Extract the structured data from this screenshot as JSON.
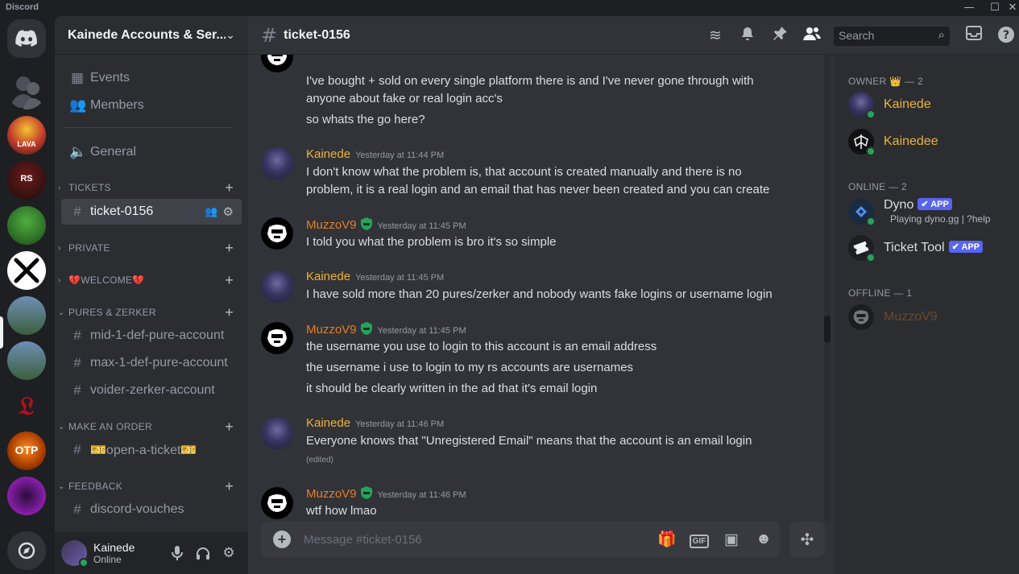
{
  "app": {
    "title": "Discord"
  },
  "window_controls": {
    "minimize": "—",
    "maximize": "☐",
    "close": "✕"
  },
  "server": {
    "name": "Kainede Accounts & Ser...",
    "rail_labels": {
      "lava": "LAVA",
      "rs": "RS",
      "otp": "OTP"
    }
  },
  "sidebar": {
    "events": "Events",
    "members": "Members",
    "general": "General",
    "categories": [
      {
        "label": "TICKETS",
        "channels": [
          "ticket-0156"
        ]
      },
      {
        "label": "PRIVATE",
        "channels": []
      },
      {
        "label": "💔WELCOME💔",
        "channels": []
      },
      {
        "label": "PURES & ZERKER",
        "channels": [
          "mid-1-def-pure-account",
          "max-1-def-pure-account",
          "voider-zerker-account"
        ]
      },
      {
        "label": "MAKE AN ORDER",
        "channels": [
          "🎫open-a-ticket🎫"
        ]
      },
      {
        "label": "FEEDBACK",
        "channels": [
          "discord-vouches"
        ]
      }
    ]
  },
  "user_panel": {
    "name": "Kainede",
    "status": "Online"
  },
  "channel": {
    "name": "ticket-0156"
  },
  "search": {
    "placeholder": "Search"
  },
  "messages": {
    "prev_lines": [
      "I've bought + sold on every single platform there is and I've never gone through with",
      "anyone about fake or real login acc's",
      "so whats the go here?"
    ],
    "groups": [
      {
        "author": "Kainede",
        "time": "Yesterday at 11:44 PM",
        "lines": [
          "I don't know what the problem is, that account is created manually and there is no",
          "problem, it is a real login and an email that has never been created and you can create"
        ]
      },
      {
        "author": "MuzzoV9",
        "time": "Yesterday at 11:45 PM",
        "lines": [
          "I told you what the problem is bro it's so simple"
        ]
      },
      {
        "author": "Kainede",
        "time": "Yesterday at 11:45 PM",
        "lines": [
          "I have sold more than 20 pures/zerker and nobody wants fake logins or username login"
        ]
      },
      {
        "author": "MuzzoV9",
        "time": "Yesterday at 11:45 PM",
        "lines": [
          "the username you use to login to this account is an email address",
          "the username i use to login to my rs accounts are usernames",
          "it should be clearly written in the ad that it's email login"
        ]
      },
      {
        "author": "Kainede",
        "time": "Yesterday at 11:46 PM",
        "lines": [
          "Everyone knows that \"Unregistered Email\" means that the account is an email login"
        ],
        "edited": "(edited)"
      },
      {
        "author": "MuzzoV9",
        "time": "Yesterday at 11:46 PM",
        "lines": [
          "wtf how lmao"
        ]
      }
    ]
  },
  "composer": {
    "placeholder": "Message #ticket-0156",
    "gif": "GIF"
  },
  "member_list": {
    "owner_header": "OWNER 👑 — 2",
    "online_header": "ONLINE — 2",
    "offline_header": "OFFLINE — 1",
    "owners": [
      "Kainede",
      "Kainedee"
    ],
    "online": [
      {
        "name": "Dyno",
        "tag": "✔ APP",
        "activity": "Playing dyno.gg | ?help"
      },
      {
        "name": "Ticket Tool",
        "tag": "✔ APP"
      }
    ],
    "offline": [
      "MuzzoV9"
    ]
  },
  "colors": {
    "kainede": "#f0b232",
    "muzzo": "#e67e22",
    "online": "#23a55a",
    "brand": "#5865f2"
  }
}
